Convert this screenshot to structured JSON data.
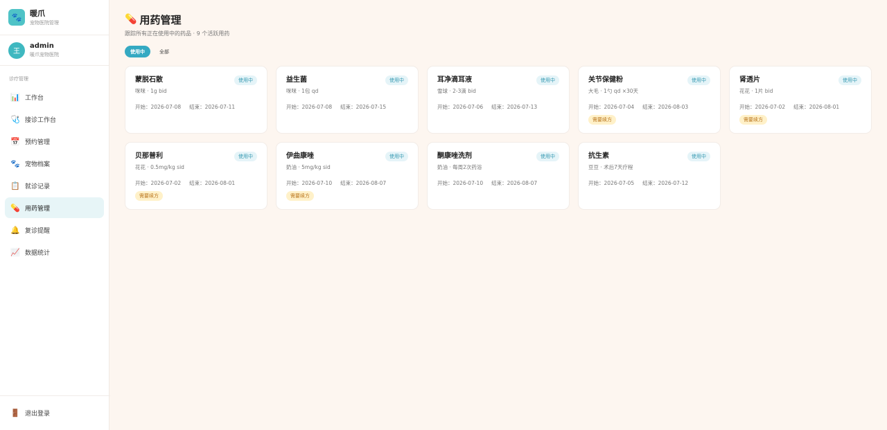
{
  "brand": {
    "logo": "🐾",
    "name": "暖爪",
    "subtitle": "宠物医院管理"
  },
  "user": {
    "avatar": "王",
    "name": "admin",
    "org": "暖爪宠物医院"
  },
  "nav": {
    "section": "诊疗管理",
    "items": [
      {
        "icon": "📊",
        "label": "工作台",
        "active": false
      },
      {
        "icon": "🩺",
        "label": "接诊工作台",
        "active": false
      },
      {
        "icon": "📅",
        "label": "预约管理",
        "active": false
      },
      {
        "icon": "🐾",
        "label": "宠物档案",
        "active": false
      },
      {
        "icon": "📋",
        "label": "就诊记录",
        "active": false
      },
      {
        "icon": "💊",
        "label": "用药管理",
        "active": true
      },
      {
        "icon": "🔔",
        "label": "复诊提醒",
        "active": false
      },
      {
        "icon": "📈",
        "label": "数据统计",
        "active": false
      }
    ],
    "logout": {
      "icon": "🚪",
      "label": "退出登录"
    }
  },
  "page": {
    "title_icon": "💊",
    "title": "用药管理",
    "subtitle": "跟踪所有正在使用中的药品 · 9 个活跃用药",
    "tabs": [
      {
        "label": "使用中",
        "active": true
      },
      {
        "label": "全部",
        "active": false
      }
    ]
  },
  "colors": {
    "accent": "#34a9c2",
    "renew_bg": "#fff1c9",
    "renew_text": "#b9741a"
  },
  "medications": [
    {
      "name": "蒙脱石散",
      "dose": "咪咪 · 1g bid",
      "status": "使用中",
      "start": "开始：2026-07-08",
      "end": "结束：2026-07-11",
      "renew": ""
    },
    {
      "name": "益生菌",
      "dose": "咪咪 · 1包 qd",
      "status": "使用中",
      "start": "开始：2026-07-08",
      "end": "结束：2026-07-15",
      "renew": ""
    },
    {
      "name": "耳净滴耳液",
      "dose": "雪球 · 2-3滴 bid",
      "status": "使用中",
      "start": "开始：2026-07-06",
      "end": "结束：2026-07-13",
      "renew": ""
    },
    {
      "name": "关节保健粉",
      "dose": "大毛 · 1勺 qd ×30天",
      "status": "使用中",
      "start": "开始：2026-07-04",
      "end": "结束：2026-08-03",
      "renew": "需要续方"
    },
    {
      "name": "肾透片",
      "dose": "花花 · 1片 bid",
      "status": "使用中",
      "start": "开始：2026-07-02",
      "end": "结束：2026-08-01",
      "renew": "需要续方"
    },
    {
      "name": "贝那普利",
      "dose": "花花 · 0.5mg/kg sid",
      "status": "使用中",
      "start": "开始：2026-07-02",
      "end": "结束：2026-08-01",
      "renew": "需要续方"
    },
    {
      "name": "伊曲康唑",
      "dose": "奶油 · 5mg/kg sid",
      "status": "使用中",
      "start": "开始：2026-07-10",
      "end": "结束：2026-08-07",
      "renew": "需要续方"
    },
    {
      "name": "酮康唑洗剂",
      "dose": "奶油 · 每周2次药浴",
      "status": "使用中",
      "start": "开始：2026-07-10",
      "end": "结束：2026-08-07",
      "renew": ""
    },
    {
      "name": "抗生素",
      "dose": "豆豆 · 术后7天疗程",
      "status": "使用中",
      "start": "开始：2026-07-05",
      "end": "结束：2026-07-12",
      "renew": ""
    }
  ]
}
